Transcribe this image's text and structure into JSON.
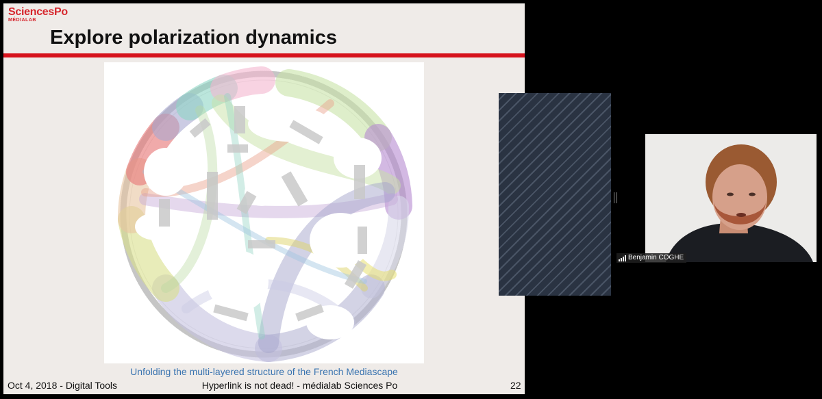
{
  "slide": {
    "logo_main": "SciencesPo",
    "logo_sub": "MÉDIALAB",
    "title": "Explore polarization dynamics",
    "caption": "Unfolding the multi-layered structure of the French Mediascape",
    "footer_left": "Oct 4, 2018 - Digital Tools",
    "footer_center": "Hyperlink is not dead! - médialab Sciences Po",
    "page_number": "22",
    "accent_color": "#d6121c"
  },
  "participant": {
    "name": "Benjamin COGHE",
    "icon": "signal-bars-icon"
  }
}
